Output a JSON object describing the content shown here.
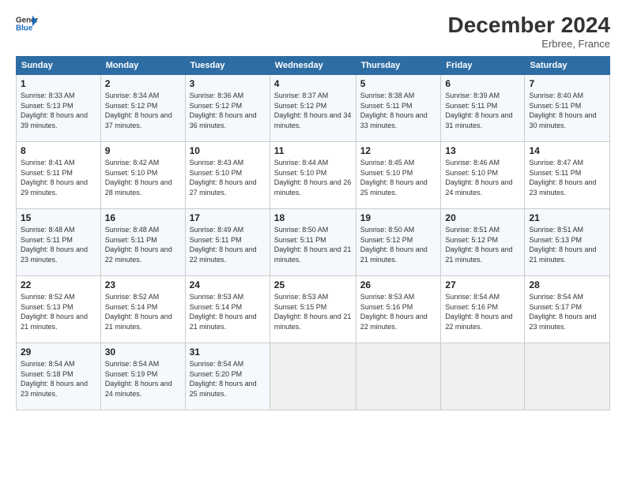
{
  "header": {
    "logo_line1": "General",
    "logo_line2": "Blue",
    "month": "December 2024",
    "location": "Erbree, France"
  },
  "days_of_week": [
    "Sunday",
    "Monday",
    "Tuesday",
    "Wednesday",
    "Thursday",
    "Friday",
    "Saturday"
  ],
  "weeks": [
    [
      {
        "day": 1,
        "sunrise": "8:33 AM",
        "sunset": "5:13 PM",
        "daylight": "8 hours and 39 minutes."
      },
      {
        "day": 2,
        "sunrise": "8:34 AM",
        "sunset": "5:12 PM",
        "daylight": "8 hours and 37 minutes."
      },
      {
        "day": 3,
        "sunrise": "8:36 AM",
        "sunset": "5:12 PM",
        "daylight": "8 hours and 36 minutes."
      },
      {
        "day": 4,
        "sunrise": "8:37 AM",
        "sunset": "5:12 PM",
        "daylight": "8 hours and 34 minutes."
      },
      {
        "day": 5,
        "sunrise": "8:38 AM",
        "sunset": "5:11 PM",
        "daylight": "8 hours and 33 minutes."
      },
      {
        "day": 6,
        "sunrise": "8:39 AM",
        "sunset": "5:11 PM",
        "daylight": "8 hours and 31 minutes."
      },
      {
        "day": 7,
        "sunrise": "8:40 AM",
        "sunset": "5:11 PM",
        "daylight": "8 hours and 30 minutes."
      }
    ],
    [
      {
        "day": 8,
        "sunrise": "8:41 AM",
        "sunset": "5:11 PM",
        "daylight": "8 hours and 29 minutes."
      },
      {
        "day": 9,
        "sunrise": "8:42 AM",
        "sunset": "5:10 PM",
        "daylight": "8 hours and 28 minutes."
      },
      {
        "day": 10,
        "sunrise": "8:43 AM",
        "sunset": "5:10 PM",
        "daylight": "8 hours and 27 minutes."
      },
      {
        "day": 11,
        "sunrise": "8:44 AM",
        "sunset": "5:10 PM",
        "daylight": "8 hours and 26 minutes."
      },
      {
        "day": 12,
        "sunrise": "8:45 AM",
        "sunset": "5:10 PM",
        "daylight": "8 hours and 25 minutes."
      },
      {
        "day": 13,
        "sunrise": "8:46 AM",
        "sunset": "5:10 PM",
        "daylight": "8 hours and 24 minutes."
      },
      {
        "day": 14,
        "sunrise": "8:47 AM",
        "sunset": "5:11 PM",
        "daylight": "8 hours and 23 minutes."
      }
    ],
    [
      {
        "day": 15,
        "sunrise": "8:48 AM",
        "sunset": "5:11 PM",
        "daylight": "8 hours and 23 minutes."
      },
      {
        "day": 16,
        "sunrise": "8:48 AM",
        "sunset": "5:11 PM",
        "daylight": "8 hours and 22 minutes."
      },
      {
        "day": 17,
        "sunrise": "8:49 AM",
        "sunset": "5:11 PM",
        "daylight": "8 hours and 22 minutes."
      },
      {
        "day": 18,
        "sunrise": "8:50 AM",
        "sunset": "5:11 PM",
        "daylight": "8 hours and 21 minutes."
      },
      {
        "day": 19,
        "sunrise": "8:50 AM",
        "sunset": "5:12 PM",
        "daylight": "8 hours and 21 minutes."
      },
      {
        "day": 20,
        "sunrise": "8:51 AM",
        "sunset": "5:12 PM",
        "daylight": "8 hours and 21 minutes."
      },
      {
        "day": 21,
        "sunrise": "8:51 AM",
        "sunset": "5:13 PM",
        "daylight": "8 hours and 21 minutes."
      }
    ],
    [
      {
        "day": 22,
        "sunrise": "8:52 AM",
        "sunset": "5:13 PM",
        "daylight": "8 hours and 21 minutes."
      },
      {
        "day": 23,
        "sunrise": "8:52 AM",
        "sunset": "5:14 PM",
        "daylight": "8 hours and 21 minutes."
      },
      {
        "day": 24,
        "sunrise": "8:53 AM",
        "sunset": "5:14 PM",
        "daylight": "8 hours and 21 minutes."
      },
      {
        "day": 25,
        "sunrise": "8:53 AM",
        "sunset": "5:15 PM",
        "daylight": "8 hours and 21 minutes."
      },
      {
        "day": 26,
        "sunrise": "8:53 AM",
        "sunset": "5:16 PM",
        "daylight": "8 hours and 22 minutes."
      },
      {
        "day": 27,
        "sunrise": "8:54 AM",
        "sunset": "5:16 PM",
        "daylight": "8 hours and 22 minutes."
      },
      {
        "day": 28,
        "sunrise": "8:54 AM",
        "sunset": "5:17 PM",
        "daylight": "8 hours and 23 minutes."
      }
    ],
    [
      {
        "day": 29,
        "sunrise": "8:54 AM",
        "sunset": "5:18 PM",
        "daylight": "8 hours and 23 minutes."
      },
      {
        "day": 30,
        "sunrise": "8:54 AM",
        "sunset": "5:19 PM",
        "daylight": "8 hours and 24 minutes."
      },
      {
        "day": 31,
        "sunrise": "8:54 AM",
        "sunset": "5:20 PM",
        "daylight": "8 hours and 25 minutes."
      },
      null,
      null,
      null,
      null
    ]
  ]
}
